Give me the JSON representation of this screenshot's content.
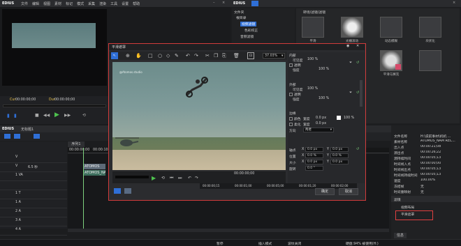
{
  "colors": {
    "accent": "#2f6fd6",
    "dialog_border": "#d23b3b",
    "highlight": "#e04040"
  },
  "player": {
    "app_title": "EDIUS",
    "menu": [
      "文件",
      "编辑",
      "视图",
      "素材",
      "标记",
      "模式",
      "采集",
      "渲染",
      "工具",
      "设置",
      "帮助"
    ],
    "cue_left": "Cur",
    "timecode_left": "00:00:00;00",
    "cue_right": "Dur",
    "timecode_right": "00:00:00;00"
  },
  "bin": {
    "app_title": "EDIUS",
    "header": "文件夹",
    "tree": [
      "根目录",
      "视频滤镜",
      "色彩校正",
      "音频滤镜"
    ],
    "effects_title": "转场/滤镜/滤镜"
  },
  "effects": [
    {
      "label": "平滑"
    },
    {
      "label": "光栅滚动"
    },
    {
      "label": "动态模糊"
    },
    {
      "label": "块状化"
    },
    {
      "label": ""
    },
    {
      "label": "平滑模糊"
    },
    {
      "label": "平滑马赛克"
    },
    {
      "label": ""
    },
    {
      "label": "柔化"
    },
    {
      "label": "模糊"
    }
  ],
  "timeline": {
    "app_title": "EDIUS",
    "seq_label": "无标题1",
    "tab": "序列1",
    "timecode": "00:00:00;00",
    "ruler_mark": "00:00:10;00",
    "tracks": [
      {
        "name": "V",
        "sub": ""
      },
      {
        "name": "V",
        "sub": "6.5 秒"
      },
      {
        "name": "1 VA",
        "sub": ""
      },
      {
        "name": "",
        "sub": ""
      },
      {
        "name": "1 T",
        "sub": ""
      },
      {
        "name": "1 A",
        "sub": ""
      },
      {
        "name": "2 A",
        "sub": ""
      },
      {
        "name": "3 A",
        "sub": ""
      },
      {
        "name": "4 A",
        "sub": ""
      }
    ],
    "clip_video": "ATOMOS",
    "clip_audio": "ATOMOS_NAM"
  },
  "info": {
    "rows": [
      {
        "key": "文件名称",
        "value": "H:\\说前事材\\机机 ..."
      },
      {
        "key": "素材名称",
        "value": "ATOMOS_NAM REC..."
      },
      {
        "key": "出入点",
        "value": "00:00:21;08"
      },
      {
        "key": "源出点",
        "value": "00:00:26;22"
      },
      {
        "key": "源持续时间",
        "value": "00:00:05;13"
      },
      {
        "key": "时间线入点",
        "value": "00:00:00;00"
      },
      {
        "key": "时间线出点",
        "value": "00:00:05;13"
      },
      {
        "key": "时间线持续时间",
        "value": "00:00:05;13"
      },
      {
        "key": "速度",
        "value": "100.00%"
      },
      {
        "key": "冻结帧",
        "value": "无"
      },
      {
        "key": "时间重映射",
        "value": "无"
      }
    ],
    "filters_header": "滤镜",
    "filters": [
      "视频布局",
      "平滑遮罩"
    ],
    "tab": "信息"
  },
  "dialog": {
    "title": "平滑遮罩",
    "zoom": "37.03%",
    "watermark": "@Atomos.studio",
    "inner_header": "内部",
    "outer_header": "外部",
    "edge_header": "边缘",
    "opacity_label": "可见度",
    "inner_opacity": "100 %",
    "transparent_label": "透明",
    "strength_label": "强度",
    "inner_strength": "100 %",
    "outer_opacity": "100 %",
    "outer_strength": "100 %",
    "color_label": "颜色",
    "soft_label": "柔化",
    "width_label": "宽度",
    "edge_color_width": "0.0 px",
    "edge_color_pct": "100 %",
    "edge_soft_width": "0.0 px",
    "direction_label": "方向",
    "direction_value": "两者",
    "pos_x_label": "轴点",
    "pos_label": "位置",
    "size_label": "大小",
    "rotate_label": "旋转",
    "x_label": "X",
    "y_label": "Y",
    "zero_px": "0.0 px",
    "zero_pct": "0.0 %",
    "size_x": "0.0 px",
    "size_y": "0.0 px",
    "rotate_value": "0.0 °",
    "timecode_start": "00:00:00;00",
    "ruler": [
      "00:00:00;15",
      "00:00:01;00",
      "00:00:05;00",
      "00:00:01;20",
      "00:00:02;00"
    ],
    "ok": "确定",
    "cancel": "取消"
  },
  "status": {
    "left": "暂停",
    "items": [
      "插入模式",
      "波纹关闭",
      "",
      "硬盘:94% 被使用(H:)"
    ]
  }
}
